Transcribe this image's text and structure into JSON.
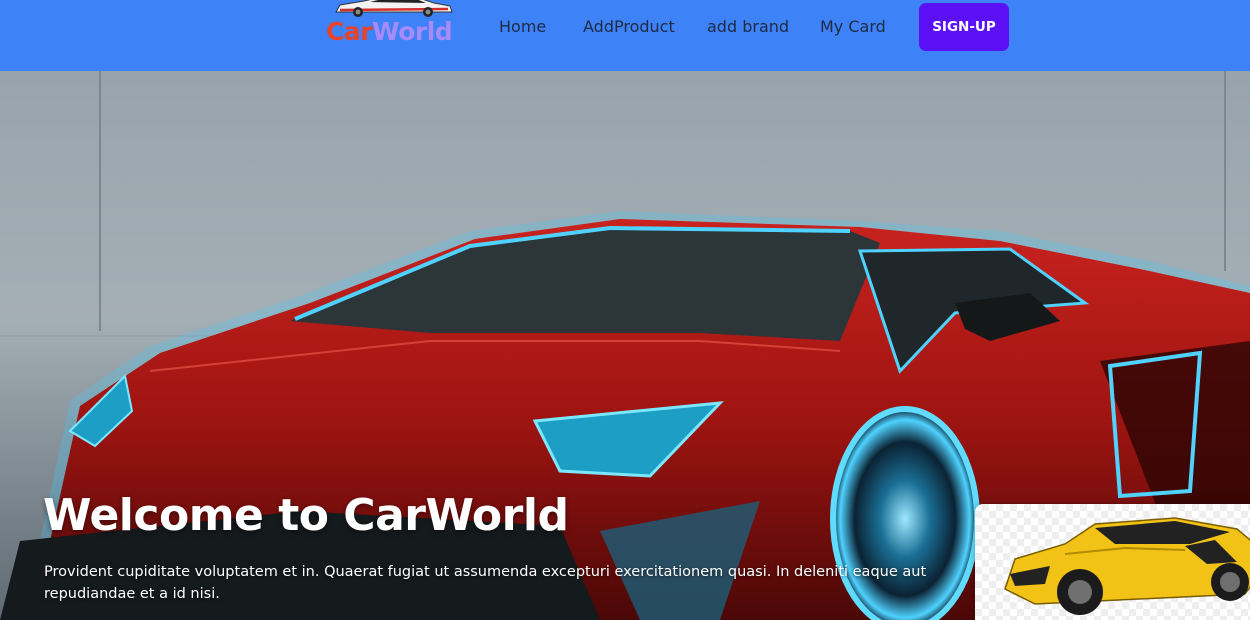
{
  "brand": {
    "name_part1": "Car",
    "name_part2": "World",
    "logo_icon": "car-logo-icon",
    "colors": {
      "part1": "#e8432c",
      "part2": "#a78bfa"
    }
  },
  "nav": {
    "links": [
      {
        "label": "Home"
      },
      {
        "label": "AddProduct"
      },
      {
        "label": "add brand"
      },
      {
        "label": "My Card"
      }
    ],
    "signup_label": "SIGN-UP",
    "colors": {
      "bar": "#3d82f7",
      "signup": "#5b10f5"
    }
  },
  "hero": {
    "title": "Welcome to CarWorld",
    "description": "Provident cupiditate voluptatem et in. Quaerat fugiat ut assumenda excepturi exercitationem quasi. In deleniti eaque aut repudiandae et a id nisi.",
    "background_image": "red-sports-car-with-blue-neon-glow",
    "thumbnail_image": "yellow-sports-car"
  }
}
